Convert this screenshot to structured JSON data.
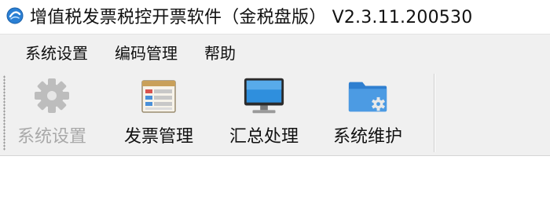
{
  "window": {
    "title": "增值税发票税控开票软件（金税盘版） V2.3.11.200530"
  },
  "menubar": {
    "items": [
      {
        "label": "系统设置"
      },
      {
        "label": "编码管理"
      },
      {
        "label": "帮助"
      }
    ]
  },
  "toolbar": {
    "buttons": [
      {
        "label": "系统设置",
        "icon": "gear-icon",
        "enabled": false
      },
      {
        "label": "发票管理",
        "icon": "invoice-table-icon",
        "enabled": true
      },
      {
        "label": "汇总处理",
        "icon": "monitor-icon",
        "enabled": true
      },
      {
        "label": "系统维护",
        "icon": "folder-gear-icon",
        "enabled": true
      }
    ]
  },
  "colors": {
    "accent": "#1a73c9",
    "menubar_bg": "#f0f0f0",
    "disabled_text": "#a9a9a9"
  }
}
